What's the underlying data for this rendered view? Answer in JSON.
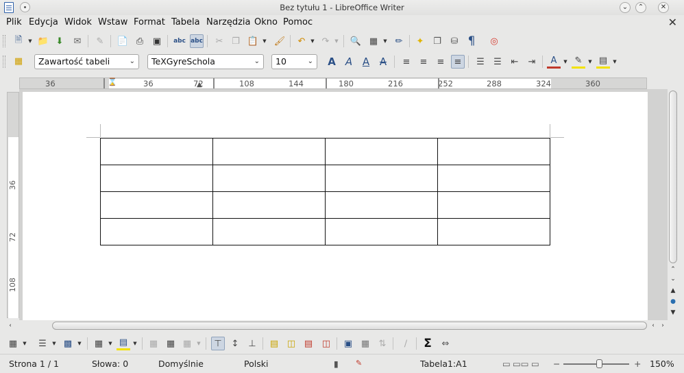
{
  "window": {
    "title": "Bez tytułu 1 - LibreOffice Writer"
  },
  "menubar": {
    "items": [
      "Plik",
      "Edycja",
      "Widok",
      "Wstaw",
      "Format",
      "Tabela",
      "Narzędzia",
      "Okno",
      "Pomoc"
    ]
  },
  "formatting": {
    "paragraph_style": "Zawartość tabeli",
    "font_name": "TeXGyreSchola",
    "font_size": "10"
  },
  "ruler": {
    "horizontal": [
      "36",
      "36",
      "72",
      "108",
      "144",
      "180",
      "216",
      "252",
      "288",
      "324",
      "360"
    ],
    "vertical": [
      "36",
      "72",
      "108"
    ]
  },
  "document": {
    "table": {
      "rows": 4,
      "cols": 4
    }
  },
  "statusbar": {
    "page": "Strona 1 / 1",
    "words": "Słowa: 0",
    "page_style": "Domyślnie",
    "language": "Polski",
    "table_cell": "Tabela1:A1",
    "zoom": "150%"
  },
  "colors": {
    "accent_blue": "#2a4f86",
    "page": "#ffffff",
    "chrome": "#e8e8e7"
  }
}
